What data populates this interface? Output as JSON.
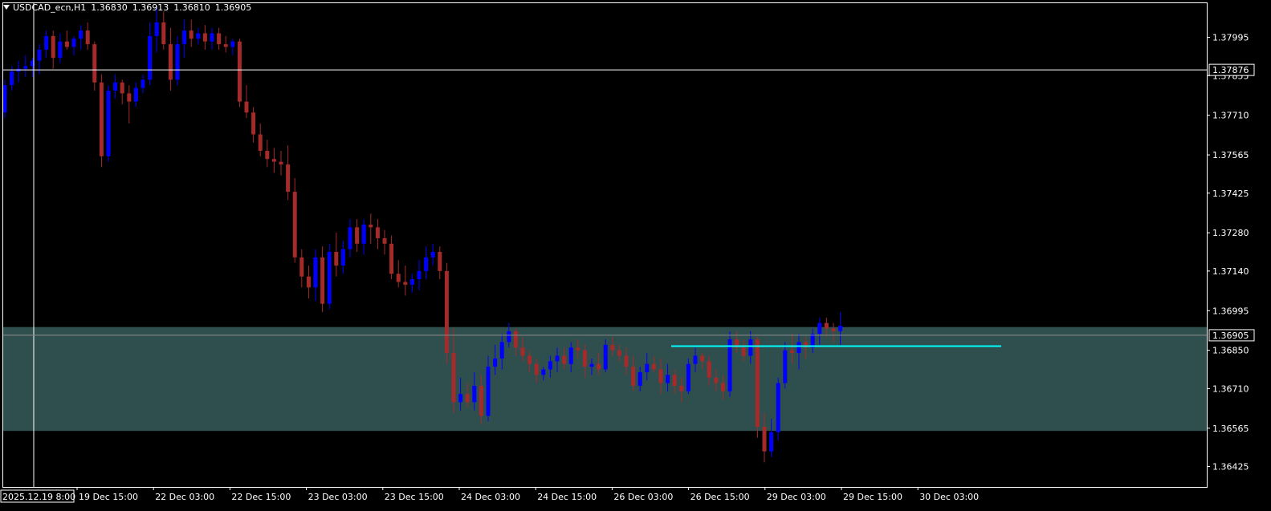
{
  "header": {
    "symbol": "USDCAD_ecn,H1",
    "open": "1.36830",
    "high": "1.36913",
    "low": "1.36810",
    "close": "1.36905"
  },
  "chart_data": {
    "type": "candlestick",
    "symbol": "USDCAD_ecn",
    "timeframe": "H1",
    "ylim": [
      1.3635,
      1.3812
    ],
    "price_ticks": [
      "1.37995",
      "1.37855",
      "1.37710",
      "1.37565",
      "1.37425",
      "1.37280",
      "1.37140",
      "1.36995",
      "1.36850",
      "1.36710",
      "1.36565",
      "1.36425"
    ],
    "time_ticks": [
      "19 Dec 15:00",
      "22 Dec 03:00",
      "22 Dec 15:00",
      "23 Dec 03:00",
      "23 Dec 15:00",
      "24 Dec 03:00",
      "24 Dec 15:00",
      "26 Dec 03:00",
      "26 Dec 15:00",
      "29 Dec 03:00",
      "29 Dec 15:00",
      "30 Dec 03:00"
    ],
    "crosshair": {
      "time_label": "2025.12.19 8:00",
      "price_label": "1.37876"
    },
    "current_price": "1.36905",
    "zone": {
      "low": 1.36555,
      "high": 1.36935,
      "color": "#2f4f4f"
    },
    "level_line": {
      "price": 1.36865,
      "color": "#00ffff"
    },
    "colors": {
      "bull": "#0000ff",
      "bear": "#a52a2a",
      "background": "#000000",
      "text": "#ffffff"
    },
    "candles": [
      [
        1.3772,
        1.3784,
        1.377,
        1.3782
      ],
      [
        1.3782,
        1.3789,
        1.378,
        1.3787
      ],
      [
        1.3787,
        1.3791,
        1.3783,
        1.3788
      ],
      [
        1.3788,
        1.3793,
        1.3785,
        1.3789
      ],
      [
        1.3789,
        1.3792,
        1.3785,
        1.3791
      ],
      [
        1.3791,
        1.3797,
        1.3786,
        1.3795
      ],
      [
        1.3795,
        1.3802,
        1.3792,
        1.38
      ],
      [
        1.38,
        1.3802,
        1.3788,
        1.3792
      ],
      [
        1.3792,
        1.3801,
        1.379,
        1.3798
      ],
      [
        1.3798,
        1.3802,
        1.3795,
        1.3796
      ],
      [
        1.3796,
        1.38,
        1.3793,
        1.3799
      ],
      [
        1.3799,
        1.3804,
        1.3795,
        1.3802
      ],
      [
        1.3802,
        1.3805,
        1.3795,
        1.3797
      ],
      [
        1.3797,
        1.3798,
        1.378,
        1.3783
      ],
      [
        1.3783,
        1.3786,
        1.3752,
        1.3756
      ],
      [
        1.3756,
        1.3782,
        1.3754,
        1.378
      ],
      [
        1.378,
        1.3786,
        1.3777,
        1.3783
      ],
      [
        1.3783,
        1.3784,
        1.3775,
        1.3779
      ],
      [
        1.3779,
        1.3782,
        1.3768,
        1.3776
      ],
      [
        1.3776,
        1.3783,
        1.3774,
        1.3781
      ],
      [
        1.3781,
        1.3786,
        1.3779,
        1.3784
      ],
      [
        1.3784,
        1.3805,
        1.3782,
        1.38
      ],
      [
        1.38,
        1.3811,
        1.3794,
        1.3805
      ],
      [
        1.3805,
        1.3809,
        1.3795,
        1.3797
      ],
      [
        1.3797,
        1.3803,
        1.378,
        1.3784
      ],
      [
        1.3784,
        1.38,
        1.3782,
        1.3797
      ],
      [
        1.3797,
        1.3806,
        1.3792,
        1.3802
      ],
      [
        1.3802,
        1.3806,
        1.3796,
        1.3799
      ],
      [
        1.3799,
        1.3803,
        1.3797,
        1.3801
      ],
      [
        1.3801,
        1.3804,
        1.3795,
        1.3798
      ],
      [
        1.3798,
        1.3803,
        1.3795,
        1.3801
      ],
      [
        1.3801,
        1.3803,
        1.3795,
        1.3797
      ],
      [
        1.3797,
        1.38,
        1.3794,
        1.3796
      ],
      [
        1.3796,
        1.3799,
        1.3793,
        1.3798
      ],
      [
        1.3798,
        1.3799,
        1.3774,
        1.3776
      ],
      [
        1.3776,
        1.3782,
        1.377,
        1.3772
      ],
      [
        1.3772,
        1.3774,
        1.3761,
        1.3764
      ],
      [
        1.3764,
        1.3768,
        1.3756,
        1.3758
      ],
      [
        1.3758,
        1.3762,
        1.3752,
        1.3755
      ],
      [
        1.3755,
        1.3759,
        1.375,
        1.3754
      ],
      [
        1.3754,
        1.3758,
        1.3749,
        1.3753
      ],
      [
        1.3753,
        1.376,
        1.374,
        1.3743
      ],
      [
        1.3743,
        1.3748,
        1.3717,
        1.3719
      ],
      [
        1.3719,
        1.3722,
        1.3708,
        1.3712
      ],
      [
        1.3712,
        1.3716,
        1.3704,
        1.3708
      ],
      [
        1.3708,
        1.3722,
        1.3703,
        1.3719
      ],
      [
        1.3719,
        1.3723,
        1.3699,
        1.3702
      ],
      [
        1.3702,
        1.3724,
        1.37,
        1.3721
      ],
      [
        1.3721,
        1.3728,
        1.3712,
        1.3716
      ],
      [
        1.3716,
        1.3725,
        1.3713,
        1.3722
      ],
      [
        1.3722,
        1.3733,
        1.3719,
        1.373
      ],
      [
        1.373,
        1.3733,
        1.3721,
        1.3724
      ],
      [
        1.3724,
        1.3733,
        1.372,
        1.3731
      ],
      [
        1.3731,
        1.3735,
        1.3724,
        1.373
      ],
      [
        1.373,
        1.3733,
        1.3722,
        1.3726
      ],
      [
        1.3726,
        1.3729,
        1.372,
        1.3724
      ],
      [
        1.3724,
        1.3727,
        1.3711,
        1.3713
      ],
      [
        1.3713,
        1.3718,
        1.3708,
        1.371
      ],
      [
        1.371,
        1.3716,
        1.3705,
        1.3709
      ],
      [
        1.3709,
        1.3713,
        1.3706,
        1.3711
      ],
      [
        1.3711,
        1.3718,
        1.3707,
        1.3714
      ],
      [
        1.3714,
        1.3723,
        1.3711,
        1.3719
      ],
      [
        1.3719,
        1.3724,
        1.3716,
        1.3721
      ],
      [
        1.3721,
        1.3723,
        1.3711,
        1.3714
      ],
      [
        1.3714,
        1.3717,
        1.368,
        1.3684
      ],
      [
        1.3684,
        1.3693,
        1.3662,
        1.3666
      ],
      [
        1.3666,
        1.3675,
        1.3663,
        1.3669
      ],
      [
        1.3669,
        1.3673,
        1.3664,
        1.3666
      ],
      [
        1.3666,
        1.3677,
        1.3663,
        1.3672
      ],
      [
        1.3672,
        1.3676,
        1.3658,
        1.3661
      ],
      [
        1.3661,
        1.3683,
        1.3659,
        1.3679
      ],
      [
        1.3679,
        1.3687,
        1.3676,
        1.3682
      ],
      [
        1.3682,
        1.3691,
        1.3678,
        1.3688
      ],
      [
        1.3688,
        1.3695,
        1.3686,
        1.3692
      ],
      [
        1.3692,
        1.3693,
        1.3683,
        1.3686
      ],
      [
        1.3686,
        1.369,
        1.3681,
        1.3683
      ],
      [
        1.3683,
        1.3685,
        1.3677,
        1.368
      ],
      [
        1.368,
        1.3682,
        1.3673,
        1.3676
      ],
      [
        1.3676,
        1.3679,
        1.3674,
        1.3678
      ],
      [
        1.3678,
        1.3683,
        1.3675,
        1.3681
      ],
      [
        1.3681,
        1.3686,
        1.3677,
        1.3683
      ],
      [
        1.3683,
        1.3686,
        1.3678,
        1.368
      ],
      [
        1.368,
        1.3688,
        1.3677,
        1.3686
      ],
      [
        1.3686,
        1.3689,
        1.3682,
        1.3685
      ],
      [
        1.3685,
        1.3687,
        1.3675,
        1.3679
      ],
      [
        1.3679,
        1.3682,
        1.3676,
        1.368
      ],
      [
        1.368,
        1.3684,
        1.3676,
        1.3678
      ],
      [
        1.3678,
        1.3689,
        1.3677,
        1.3687
      ],
      [
        1.3687,
        1.369,
        1.3683,
        1.3685
      ],
      [
        1.3685,
        1.3687,
        1.3681,
        1.3683
      ],
      [
        1.3683,
        1.3686,
        1.3676,
        1.3679
      ],
      [
        1.3679,
        1.3683,
        1.367,
        1.3672
      ],
      [
        1.3672,
        1.3679,
        1.367,
        1.3677
      ],
      [
        1.3677,
        1.3684,
        1.3674,
        1.368
      ],
      [
        1.368,
        1.3683,
        1.3677,
        1.3678
      ],
      [
        1.3678,
        1.3682,
        1.3669,
        1.3673
      ],
      [
        1.3673,
        1.368,
        1.367,
        1.3676
      ],
      [
        1.3676,
        1.3678,
        1.3669,
        1.3672
      ],
      [
        1.3672,
        1.3675,
        1.3666,
        1.367
      ],
      [
        1.367,
        1.3682,
        1.3669,
        1.368
      ],
      [
        1.368,
        1.3686,
        1.3677,
        1.3683
      ],
      [
        1.3683,
        1.3684,
        1.3678,
        1.3681
      ],
      [
        1.3681,
        1.3683,
        1.3672,
        1.3675
      ],
      [
        1.3675,
        1.3678,
        1.367,
        1.3673
      ],
      [
        1.3673,
        1.3676,
        1.3667,
        1.367
      ],
      [
        1.367,
        1.3692,
        1.3668,
        1.3689
      ],
      [
        1.3689,
        1.3692,
        1.3684,
        1.3686
      ],
      [
        1.3686,
        1.3689,
        1.3681,
        1.3683
      ],
      [
        1.3683,
        1.3692,
        1.368,
        1.3689
      ],
      [
        1.3689,
        1.369,
        1.3653,
        1.3657
      ],
      [
        1.3657,
        1.3662,
        1.3644,
        1.3648
      ],
      [
        1.3648,
        1.366,
        1.3646,
        1.3655
      ],
      [
        1.3655,
        1.3675,
        1.3652,
        1.3673
      ],
      [
        1.3673,
        1.3688,
        1.3671,
        1.3685
      ],
      [
        1.3685,
        1.3691,
        1.368,
        1.3684
      ],
      [
        1.3684,
        1.3691,
        1.3678,
        1.3688
      ],
      [
        1.3688,
        1.369,
        1.3682,
        1.3686
      ],
      [
        1.3686,
        1.3693,
        1.3684,
        1.3691
      ],
      [
        1.3691,
        1.3697,
        1.3687,
        1.3695
      ],
      [
        1.3695,
        1.3697,
        1.369,
        1.3693
      ],
      [
        1.3693,
        1.3695,
        1.3688,
        1.3692
      ],
      [
        1.3692,
        1.3699,
        1.3687,
        1.3694
      ]
    ]
  }
}
